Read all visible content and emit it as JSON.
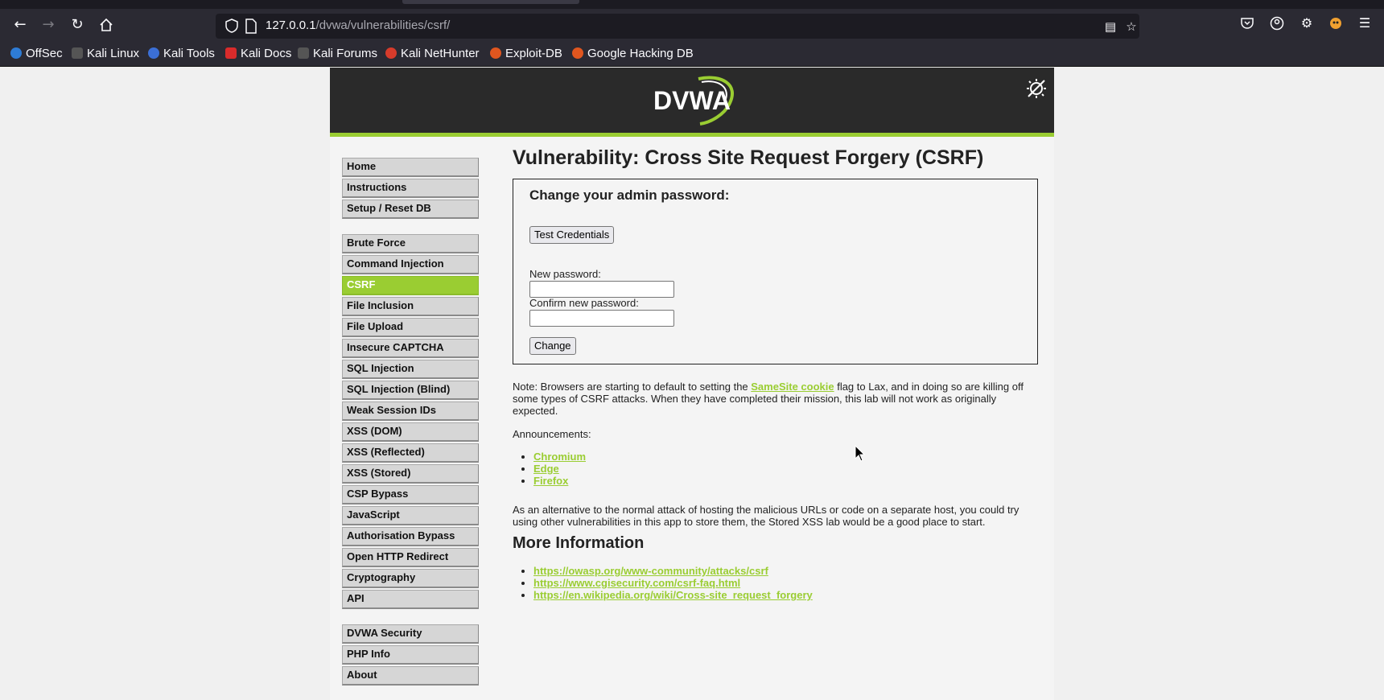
{
  "browser": {
    "url_host": "127.0.0.1",
    "url_path": "/dvwa/vulnerabilities/csrf/",
    "bookmarks": [
      {
        "label": "OffSec",
        "color": "#2e7cd6"
      },
      {
        "label": "Kali Linux",
        "color": "#4a4a4a"
      },
      {
        "label": "Kali Tools",
        "color": "#3b6fd6"
      },
      {
        "label": "Kali Docs",
        "color": "#d92b2b"
      },
      {
        "label": "Kali Forums",
        "color": "#4a4a4a"
      },
      {
        "label": "Kali NetHunter",
        "color": "#d63b2b"
      },
      {
        "label": "Exploit-DB",
        "color": "#e0561f"
      },
      {
        "label": "Google Hacking DB",
        "color": "#e0561f"
      }
    ]
  },
  "header": {
    "logo_text": "DVWA"
  },
  "menu": {
    "group1": [
      "Home",
      "Instructions",
      "Setup / Reset DB"
    ],
    "group2": [
      "Brute Force",
      "Command Injection",
      "CSRF",
      "File Inclusion",
      "File Upload",
      "Insecure CAPTCHA",
      "SQL Injection",
      "SQL Injection (Blind)",
      "Weak Session IDs",
      "XSS (DOM)",
      "XSS (Reflected)",
      "XSS (Stored)",
      "CSP Bypass",
      "JavaScript",
      "Authorisation Bypass",
      "Open HTTP Redirect",
      "Cryptography",
      "API"
    ],
    "group3": [
      "DVWA Security",
      "PHP Info",
      "About"
    ],
    "selected": "CSRF"
  },
  "main": {
    "title": "Vulnerability: Cross Site Request Forgery (CSRF)",
    "box_heading": "Change your admin password:",
    "test_button": "Test Credentials",
    "new_password_label": "New password:",
    "confirm_password_label": "Confirm new password:",
    "change_button": "Change",
    "note_prefix": "Note: Browsers are starting to default to setting the ",
    "note_link": "SameSite cookie",
    "note_suffix": " flag to Lax, and in doing so are killing off some types of CSRF attacks. When they have completed their mission, this lab will not work as originally expected.",
    "announcements_label": "Announcements:",
    "announcements": [
      "Chromium",
      "Edge",
      "Firefox"
    ],
    "alternative_text": "As an alternative to the normal attack of hosting the malicious URLs or code on a separate host, you could try using other vulnerabilities in this app to store them, the Stored XSS lab would be a good place to start.",
    "more_info_heading": "More Information",
    "more_info_links": [
      "https://owasp.org/www-community/attacks/csrf",
      "https://www.cgisecurity.com/csrf-faq.html",
      "https://en.wikipedia.org/wiki/Cross-site_request_forgery"
    ]
  },
  "colors": {
    "accent": "#9acd32",
    "header_bg": "#2a2a2a",
    "browser_bg": "#2b2a33"
  }
}
